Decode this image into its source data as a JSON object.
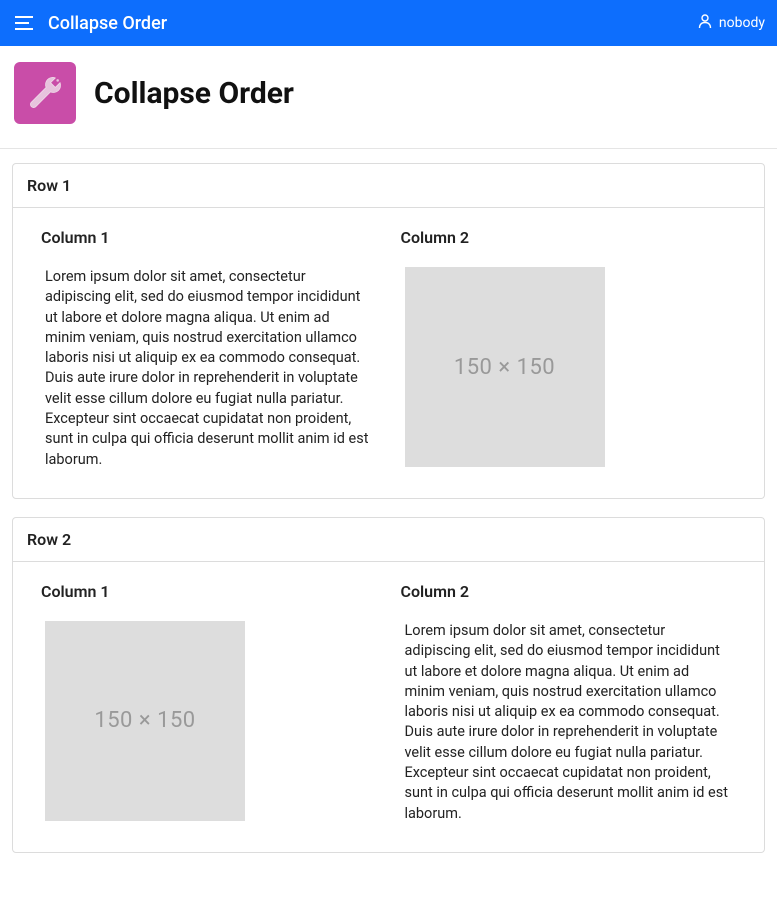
{
  "topbar": {
    "title": "Collapse Order",
    "user": "nobody"
  },
  "page": {
    "title": "Collapse Order"
  },
  "rows": [
    {
      "title": "Row 1",
      "col1": {
        "title": "Column 1",
        "text": "Lorem ipsum dolor sit amet, consectetur adipiscing elit, sed do eiusmod tempor incididunt ut labore et dolore magna aliqua. Ut enim ad minim veniam, quis nostrud exercitation ullamco laboris nisi ut aliquip ex ea commodo consequat. Duis aute irure dolor in reprehenderit in voluptate velit esse cillum dolore eu fugiat nulla pariatur. Excepteur sint occaecat cupidatat non proident, sunt in culpa qui officia deserunt mollit anim id est laborum."
      },
      "col2": {
        "title": "Column 2",
        "placeholder": "150 × 150"
      }
    },
    {
      "title": "Row 2",
      "col1": {
        "title": "Column 1",
        "placeholder": "150 × 150"
      },
      "col2": {
        "title": "Column 2",
        "text": "Lorem ipsum dolor sit amet, consectetur adipiscing elit, sed do eiusmod tempor incididunt ut labore et dolore magna aliqua. Ut enim ad minim veniam, quis nostrud exercitation ullamco laboris nisi ut aliquip ex ea commodo consequat. Duis aute irure dolor in reprehenderit in voluptate velit esse cillum dolore eu fugiat nulla pariatur. Excepteur sint occaecat cupidatat non proident, sunt in culpa qui officia deserunt mollit anim id est laborum."
      }
    }
  ]
}
